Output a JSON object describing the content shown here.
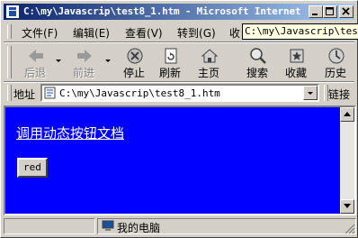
{
  "window": {
    "title": "C:\\my\\Javascrip\\test8_1.htm - Microsoft Internet ..."
  },
  "menu": {
    "items": [
      {
        "label": "文件",
        "key": "(F)"
      },
      {
        "label": "编辑",
        "key": "(E)"
      },
      {
        "label": "查看",
        "key": "(V)"
      },
      {
        "label": "转到",
        "key": "(G)"
      },
      {
        "label": "收",
        "key": ""
      }
    ],
    "tooltip": "C:\\my\\Javascrip\\test8_1.htm"
  },
  "toolbar": {
    "back": "后退",
    "forward": "前进",
    "stop": "停止",
    "refresh": "刷新",
    "home": "主页",
    "search": "搜索",
    "favorites": "收藏",
    "history": "历史"
  },
  "address": {
    "label": "地址",
    "url": "C:\\my\\Javascrip\\test8_1.htm",
    "links": "链接"
  },
  "page": {
    "link_text": "调用动态按钮文档",
    "button_label": "red",
    "background": "#0000ff"
  },
  "status": {
    "zone": "我的电脑"
  }
}
